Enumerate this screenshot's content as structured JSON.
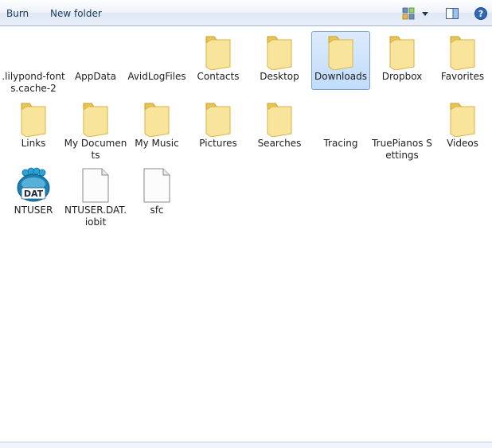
{
  "toolbar": {
    "burn_label": "Burn",
    "new_folder_label": "New folder",
    "view_icon": "view-options-icon",
    "view_menu_icon": "chevron-down-icon",
    "preview_pane_icon": "preview-pane-icon",
    "help_icon": "help-icon"
  },
  "items": [
    {
      "name": ".lilypond-fonts.cache-2",
      "type": "none"
    },
    {
      "name": "AppData",
      "type": "none"
    },
    {
      "name": "AvidLogFiles",
      "type": "none"
    },
    {
      "name": "Contacts",
      "type": "folder"
    },
    {
      "name": "Desktop",
      "type": "folder"
    },
    {
      "name": "Downloads",
      "type": "folder",
      "selected": true
    },
    {
      "name": "Dropbox",
      "type": "folder"
    },
    {
      "name": "Favorites",
      "type": "folder"
    },
    {
      "name": "Links",
      "type": "folder"
    },
    {
      "name": "My Documents",
      "type": "folder"
    },
    {
      "name": "My Music",
      "type": "folder"
    },
    {
      "name": "Pictures",
      "type": "folder"
    },
    {
      "name": "Searches",
      "type": "folder"
    },
    {
      "name": "Tracing",
      "type": "none"
    },
    {
      "name": "TruePianos Settings",
      "type": "none"
    },
    {
      "name": "Videos",
      "type": "folder"
    },
    {
      "name": "NTUSER",
      "type": "dat",
      "badge": "DAT"
    },
    {
      "name": "NTUSER.DAT.iobit",
      "type": "file"
    },
    {
      "name": "sfc",
      "type": "file"
    }
  ],
  "colors": {
    "folder_back": "#e9c554",
    "folder_front": "#f8e59b",
    "selection": "#c1dcfc",
    "selection_border": "#7da2ce",
    "dat_blue": "#1a7fb5"
  }
}
